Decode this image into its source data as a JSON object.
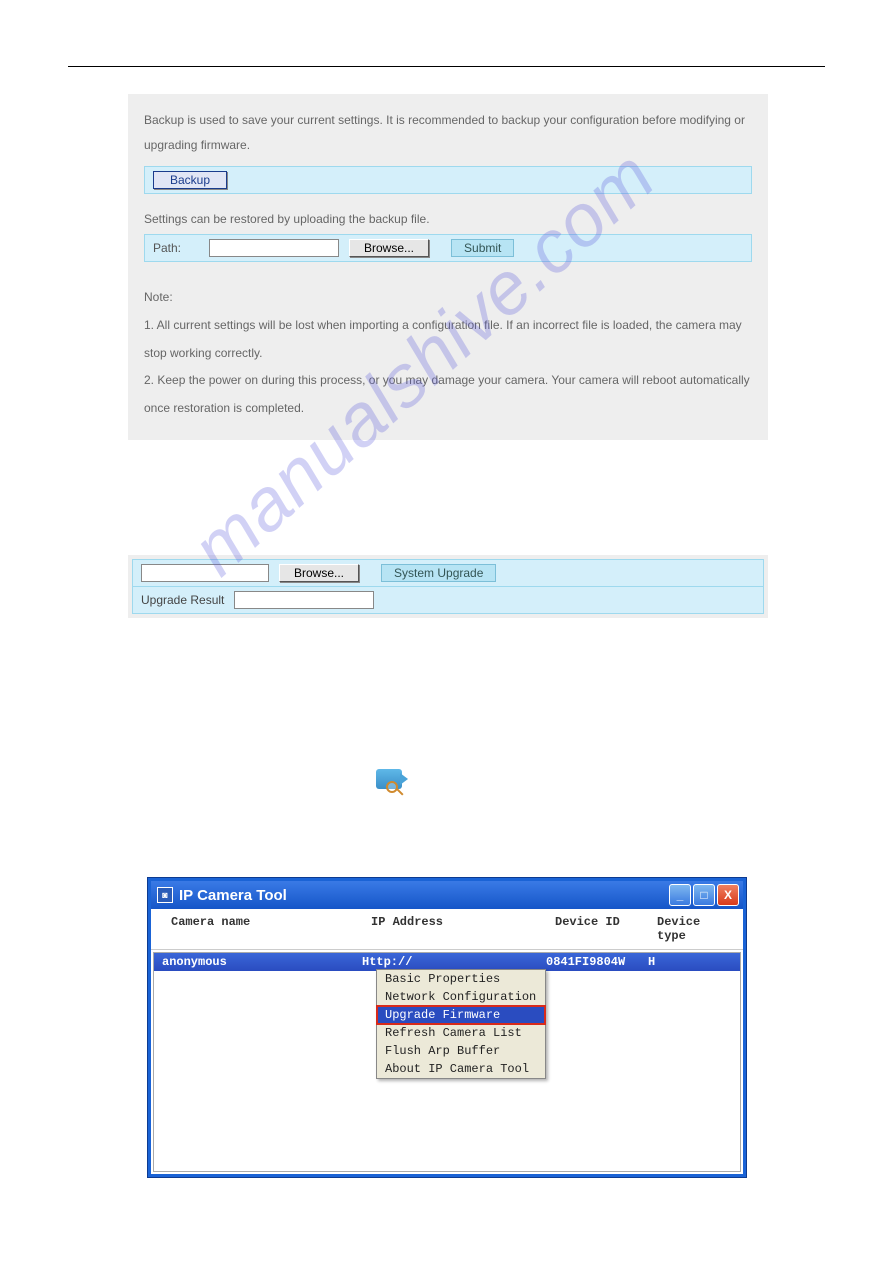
{
  "panel1": {
    "intro": "Backup is used to save your current settings. It is recommended to backup your configuration before modifying or upgrading firmware.",
    "backup_btn": "Backup",
    "restore_intro": "Settings can be restored by uploading the backup file.",
    "path_label": "Path:",
    "browse_btn": "Browse...",
    "submit_btn": "Submit",
    "note_title": "Note:",
    "note1": "1. All current settings will be lost when importing a configuration file. If an incorrect file is loaded, the camera may stop working correctly.",
    "note2": "2. Keep the power on during this process, or you may damage your camera. Your camera will reboot automatically once restoration is completed."
  },
  "panel2": {
    "browse_btn": "Browse...",
    "system_upgrade_btn": "System Upgrade",
    "result_label": "Upgrade Result"
  },
  "watermark": "manualshive.com",
  "window": {
    "title": "IP Camera Tool",
    "columns": {
      "name": "Camera name",
      "ip": "IP Address",
      "id": "Device ID",
      "type": "Device type"
    },
    "row": {
      "name": "anonymous",
      "ip": "Http://",
      "id": "0841FI9804W",
      "type": "H"
    },
    "menu": {
      "basic": "Basic Properties",
      "network": "Network Configuration",
      "upgrade": "Upgrade Firmware",
      "refresh": "Refresh Camera List",
      "flush": "Flush Arp Buffer",
      "about": "About IP Camera Tool"
    },
    "buttons": {
      "min": "_",
      "max": "□",
      "close": "X"
    }
  }
}
